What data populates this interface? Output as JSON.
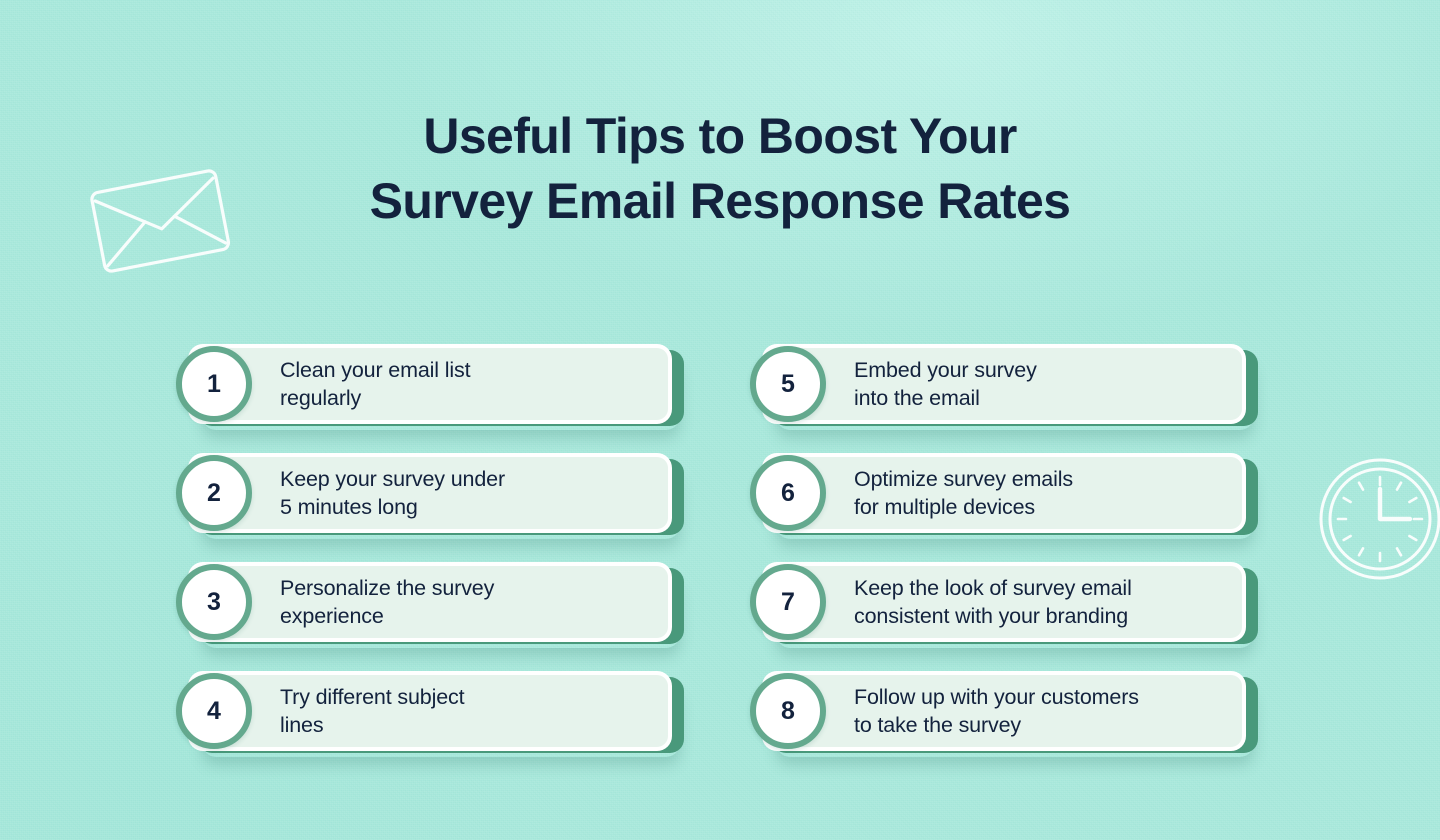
{
  "theme": {
    "background_color": "#a6e7da",
    "card_background": "#e6f3ec",
    "card_outline": "#ffffff",
    "card_shadow_color": "#49997b",
    "badge_ring_color": "#64a98e",
    "text_color": "#13223d"
  },
  "title": {
    "line1": "Useful Tips to Boost Your",
    "line2": "Survey Email Response Rates"
  },
  "decorations": [
    {
      "name": "envelope-icon",
      "label": "Envelope outline illustration"
    },
    {
      "name": "clock-icon",
      "label": "Clock outline illustration"
    }
  ],
  "tips": [
    {
      "number": "1",
      "line1": "Clean your email list",
      "line2": "regularly"
    },
    {
      "number": "5",
      "line1": "Embed your survey",
      "line2": "into the email"
    },
    {
      "number": "2",
      "line1": "Keep your survey under",
      "line2": "5 minutes long"
    },
    {
      "number": "6",
      "line1": "Optimize survey emails",
      "line2": "for multiple devices"
    },
    {
      "number": "3",
      "line1": "Personalize the survey",
      "line2": "experience"
    },
    {
      "number": "7",
      "line1": "Keep the look of survey email",
      "line2": "consistent with your branding"
    },
    {
      "number": "4",
      "line1": "Try different subject",
      "line2": "lines"
    },
    {
      "number": "8",
      "line1": "Follow up with your customers",
      "line2": "to take the survey"
    }
  ]
}
